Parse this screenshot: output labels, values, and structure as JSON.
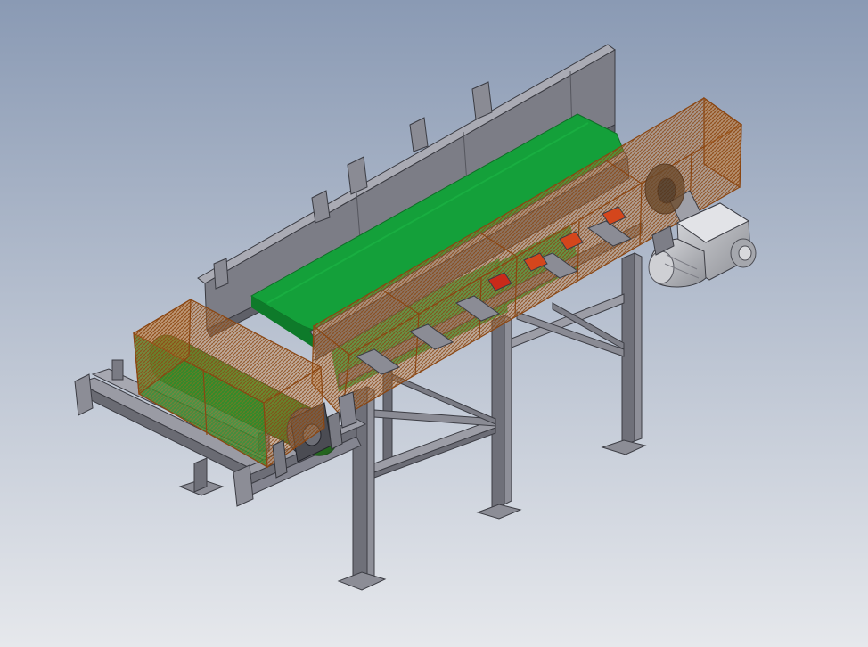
{
  "scene": {
    "background_top": "#8a9ab4",
    "background_bottom": "#e6e8ec",
    "colors": {
      "frame_steel": "#7e7f88",
      "frame_steel_dark": "#5d5e66",
      "frame_steel_light": "#a3a4ad",
      "belt_green": "#1a9c3a",
      "belt_green_dark": "#14722b",
      "mesh_guard": "#b5651d",
      "motor_grey": "#b9bbc0"
    }
  }
}
